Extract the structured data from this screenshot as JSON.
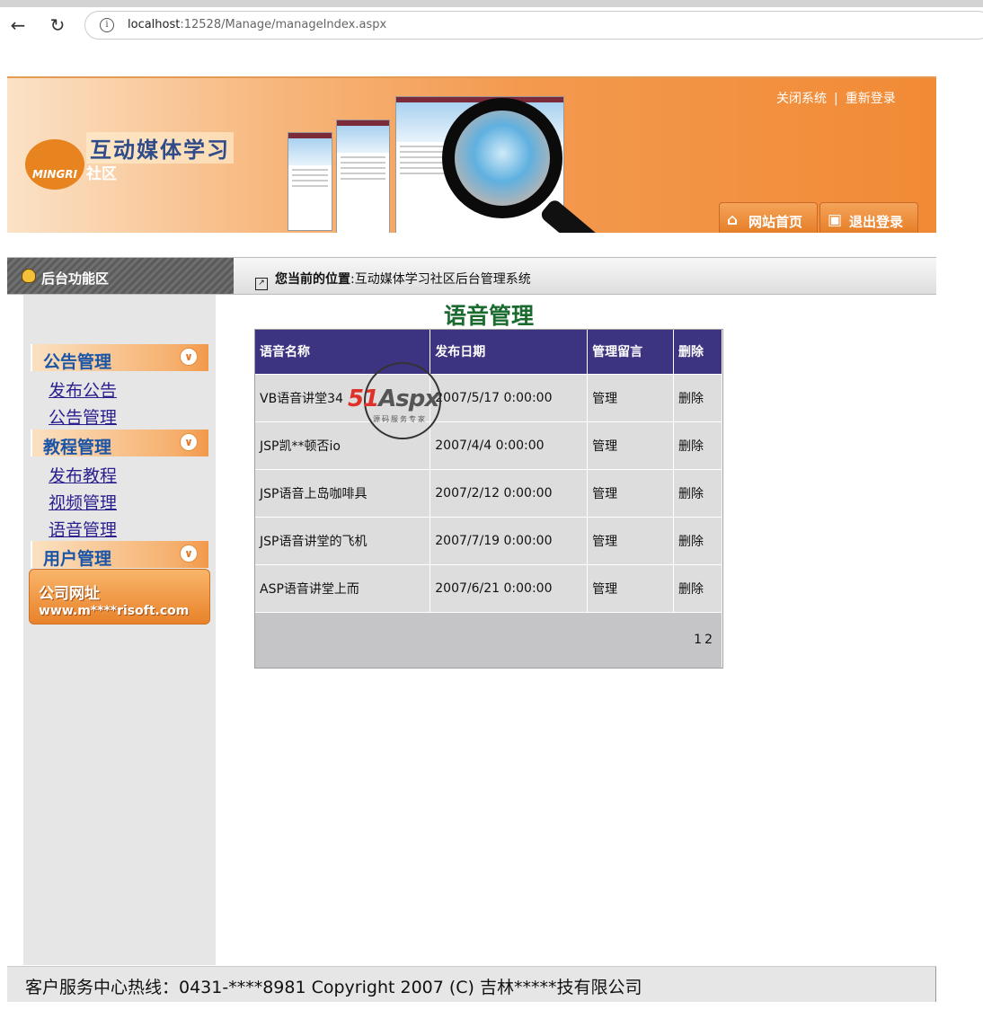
{
  "browser": {
    "url_host": "localhost",
    "url_rest": ":12528/Manage/manageIndex.aspx"
  },
  "header": {
    "site_name": "互动媒体学习",
    "site_sub": "社区",
    "logo_text": "MINGRI",
    "top_links": [
      "关闭系统",
      "重新登录"
    ],
    "buttons": [
      "网站首页",
      "退出登录"
    ]
  },
  "posbar": {
    "left_label": "后台功能区",
    "location_label": "您当前的位置",
    "location_value": "互动媒体学习社区后台管理系统"
  },
  "sidebar": {
    "groups": [
      {
        "title": "公告管理",
        "items": [
          "发布公告",
          "公告管理"
        ]
      },
      {
        "title": "教程管理",
        "items": [
          "发布教程",
          "视频管理",
          "语音管理"
        ]
      },
      {
        "title": "用户管理",
        "items": []
      }
    ],
    "company": {
      "title": "公司网址",
      "url": "www.m****risoft.com"
    }
  },
  "main": {
    "title": "语音管理",
    "columns": [
      "语音名称",
      "发布日期",
      "管理留言",
      "删除"
    ],
    "rows": [
      {
        "name": "VB语音讲堂34",
        "date": "2007/5/17 0:00:00",
        "manage": "管理",
        "delete": "删除"
      },
      {
        "name": "JSP凯**顿否io",
        "date": "2007/4/4 0:00:00",
        "manage": "管理",
        "delete": "删除"
      },
      {
        "name": "JSP语音上岛咖啡具",
        "date": "2007/2/12 0:00:00",
        "manage": "管理",
        "delete": "删除"
      },
      {
        "name": "JSP语音讲堂的飞机",
        "date": "2007/7/19 0:00:00",
        "manage": "管理",
        "delete": "删除"
      },
      {
        "name": "ASP语音讲堂上而",
        "date": "2007/6/21 0:00:00",
        "manage": "管理",
        "delete": "删除"
      }
    ],
    "pages": [
      "1",
      "2"
    ]
  },
  "watermark": {
    "brand_red": "51",
    "brand_gray": "Aspx",
    "sub": "源码服务专家"
  },
  "footer": {
    "text": "客户服务中心热线：0431-****8981 Copyright 2007 (C) 吉林*****技有限公司"
  }
}
